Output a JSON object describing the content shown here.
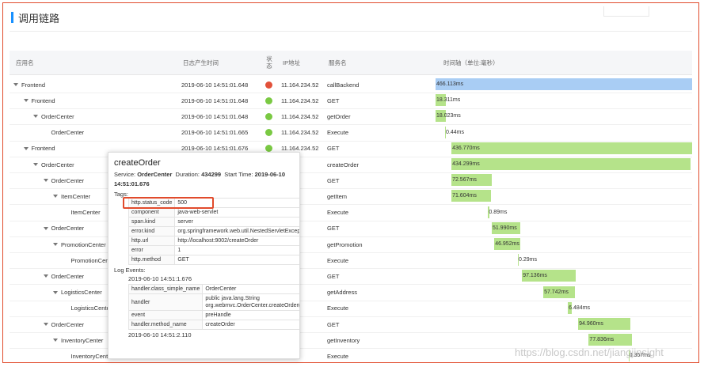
{
  "header": {
    "title": "调用链路"
  },
  "columns": {
    "app": "应用名",
    "time": "日志产生时间",
    "state": "状态",
    "ip": "IP地址",
    "service": "服务名",
    "timeline": "时间轴（单位:毫秒）"
  },
  "colors": {
    "accent": "#1890ff",
    "ok": "#7ac943",
    "error": "#e2513a",
    "bar_root": "#a9cdf4",
    "bar": "#b5e38a",
    "highlight": "#e14b2c"
  },
  "rows": [
    {
      "app": "Frontend",
      "level": 0,
      "caret": true,
      "time": "2019-06-10 14:51:01.648",
      "status": "error",
      "ip": "11.164.234.52",
      "service": "callBackend",
      "duration_label": "466.113ms",
      "start_frac": 0.0,
      "width_frac": 1.0,
      "root": true
    },
    {
      "app": "Frontend",
      "level": 1,
      "caret": true,
      "time": "2019-06-10 14:51:01.648",
      "status": "ok",
      "ip": "11.164.234.52",
      "service": "GET",
      "duration_label": "18.311ms",
      "start_frac": 0.0,
      "width_frac": 0.039
    },
    {
      "app": "OrderCenter",
      "level": 2,
      "caret": true,
      "time": "2019-06-10 14:51:01.648",
      "status": "ok",
      "ip": "11.164.234.52",
      "service": "getOrder",
      "duration_label": "18.023ms",
      "start_frac": 0.0,
      "width_frac": 0.039
    },
    {
      "app": "OrderCenter",
      "level": 3,
      "caret": false,
      "time": "2019-06-10 14:51:01.665",
      "status": "ok",
      "ip": "11.164.234.52",
      "service": "Execute",
      "duration_label": "0.44ms",
      "start_frac": 0.037,
      "width_frac": 0.004
    },
    {
      "app": "Frontend",
      "level": 1,
      "caret": true,
      "time": "2019-06-10 14:51:01.676",
      "status": "ok",
      "ip": "11.164.234.52",
      "service": "GET",
      "duration_label": "436.770ms",
      "start_frac": 0.062,
      "width_frac": 0.938
    },
    {
      "app": "OrderCenter",
      "level": 2,
      "caret": true,
      "time": "",
      "status": "",
      "ip": "",
      "service": "createOrder",
      "duration_label": "434.299ms",
      "start_frac": 0.062,
      "width_frac": 0.932
    },
    {
      "app": "OrderCenter",
      "level": 3,
      "caret": true,
      "time": "",
      "status": "",
      "ip": "",
      "service": "GET",
      "duration_label": "72.567ms",
      "start_frac": 0.062,
      "width_frac": 0.156
    },
    {
      "app": "ItemCenter",
      "level": 4,
      "caret": true,
      "time": "",
      "status": "",
      "ip": "",
      "service": "getItem",
      "duration_label": "71.604ms",
      "start_frac": 0.062,
      "width_frac": 0.154
    },
    {
      "app": "ItemCenter",
      "level": 5,
      "caret": false,
      "time": "",
      "status": "",
      "ip": "",
      "service": "Execute",
      "duration_label": "0.89ms",
      "start_frac": 0.205,
      "width_frac": 0.004
    },
    {
      "app": "OrderCenter",
      "level": 3,
      "caret": true,
      "time": "",
      "status": "",
      "ip": "",
      "service": "GET",
      "duration_label": "51.990ms",
      "start_frac": 0.219,
      "width_frac": 0.112
    },
    {
      "app": "PromotionCenter",
      "level": 4,
      "caret": true,
      "time": "",
      "status": "",
      "ip": "",
      "service": "getPromotion",
      "duration_label": "46.952ms",
      "start_frac": 0.229,
      "width_frac": 0.101
    },
    {
      "app": "PromotionCenter",
      "level": 5,
      "caret": false,
      "time": "",
      "status": "",
      "ip": "",
      "service": "Execute",
      "duration_label": "0.29ms",
      "start_frac": 0.321,
      "width_frac": 0.003
    },
    {
      "app": "OrderCenter",
      "level": 3,
      "caret": true,
      "time": "",
      "status": "",
      "ip": "",
      "service": "GET",
      "duration_label": "97.136ms",
      "start_frac": 0.337,
      "width_frac": 0.208
    },
    {
      "app": "LogisticsCenter",
      "level": 4,
      "caret": true,
      "time": "",
      "status": "",
      "ip": "",
      "service": "getAddress",
      "duration_label": "57.742ms",
      "start_frac": 0.42,
      "width_frac": 0.124
    },
    {
      "app": "LogisticsCenter",
      "level": 5,
      "caret": false,
      "time": "",
      "status": "",
      "ip": "",
      "service": "Execute",
      "duration_label": "6.484ms",
      "start_frac": 0.516,
      "width_frac": 0.014
    },
    {
      "app": "OrderCenter",
      "level": 3,
      "caret": true,
      "time": "",
      "status": "",
      "ip": "",
      "service": "GET",
      "duration_label": "94.960ms",
      "start_frac": 0.556,
      "width_frac": 0.204
    },
    {
      "app": "InventoryCenter",
      "level": 4,
      "caret": true,
      "time": "",
      "status": "",
      "ip": "",
      "service": "getInventory",
      "duration_label": "77.836ms",
      "start_frac": 0.597,
      "width_frac": 0.167
    },
    {
      "app": "InventoryCenter",
      "level": 5,
      "caret": false,
      "time": "",
      "status": "",
      "ip": "",
      "service": "Execute",
      "duration_label": "0.367ms",
      "start_frac": 0.752,
      "width_frac": 0.003
    }
  ],
  "popup": {
    "title": "createOrder",
    "service_label": "Service:",
    "service": "OrderCenter",
    "duration_label": "Duration:",
    "duration": "434299",
    "start_label": "Start Time:",
    "start_time": "2019-06-10 14:51:01.676",
    "tags_label": "Tags:",
    "tags": [
      {
        "k": "http.status_code",
        "v": "500"
      },
      {
        "k": "component",
        "v": "java-web-servlet"
      },
      {
        "k": "span.kind",
        "v": "server"
      },
      {
        "k": "error.kind",
        "v": "org.springframework.web.util.NestedServletException"
      },
      {
        "k": "http.url",
        "v": "http://localhost:9002/createOrder"
      },
      {
        "k": "error",
        "v": "1"
      },
      {
        "k": "http.method",
        "v": "GET"
      }
    ],
    "log_events_label": "Log Events:",
    "event_time_1": "2019-06-10 14:51:1.676",
    "events": [
      {
        "k": "handler.class_simple_name",
        "v": "OrderCenter"
      },
      {
        "k": "handler",
        "v": "public java.lang.String org.webmvc.OrderCenter.createOrder(int)"
      },
      {
        "k": "event",
        "v": "preHandle"
      },
      {
        "k": "handler.method_name",
        "v": "createOrder"
      }
    ],
    "event_time_2": "2019-06-10 14:51:2.110"
  },
  "watermark": "https://blog.csdn.net/jiangjinsight"
}
